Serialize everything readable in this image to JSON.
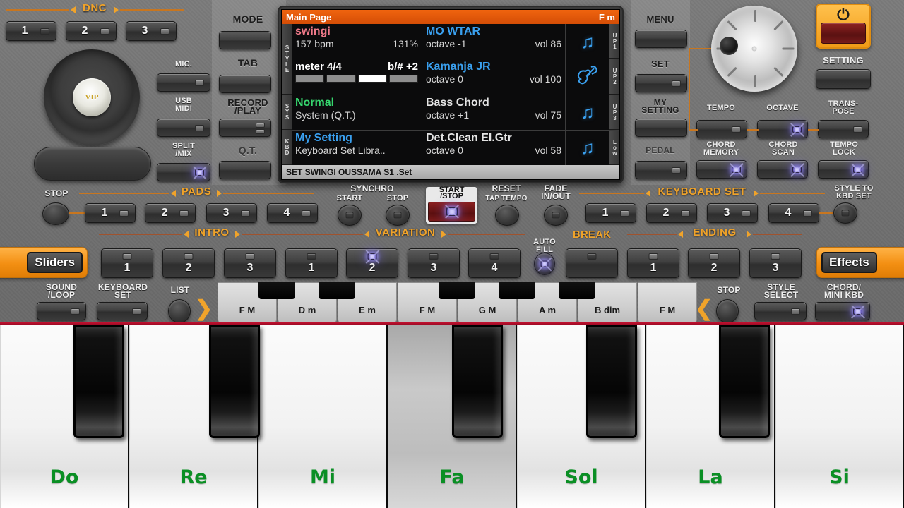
{
  "display": {
    "title": "Main Page",
    "chord": "F m",
    "side_tabs_left": [
      "STYLE",
      "SYS",
      "KBD"
    ],
    "side_tabs_right": [
      "UP1",
      "UP2",
      "UP3",
      "Low"
    ],
    "rows": [
      {
        "left_name": "swingi",
        "left_line2_a": "157 bpm",
        "left_line2_b": "131%",
        "left_line3_a": "meter 4/4",
        "left_line3_b": "b/# +2",
        "beats": [
          0,
          0,
          1,
          0
        ],
        "right_name": "MO WTAR",
        "right_octave": "octave -1",
        "right_vol": "vol 86",
        "icon": "music-note-icon",
        "tab": "UP1"
      },
      {
        "right_name": "Kamanja JR",
        "right_octave": "octave  0",
        "right_vol": "vol 100",
        "icon": "violin-icon",
        "tab": "UP2"
      },
      {
        "left_name": "Normal",
        "left_sub": "System (Q.T.)",
        "right_name": "Bass Chord",
        "right_octave": "octave +1",
        "right_vol": "vol 75",
        "icon": "music-note-icon",
        "tab": "UP3"
      },
      {
        "left_name": "My Setting",
        "left_sub": "Keyboard Set Libra..",
        "right_name": "Det.Clean El.Gtr",
        "right_octave": "octave  0",
        "right_vol": "vol 58",
        "icon": "music-note-icon",
        "tab": "Low"
      }
    ],
    "footer": "SET SWINGI OUSSAMA S1 .Set"
  },
  "dnc": {
    "label": "DNC",
    "buttons": [
      "1",
      "2",
      "3"
    ]
  },
  "jog": {
    "center_label": "VIP"
  },
  "left_side_buttons": [
    {
      "label": "MIC."
    },
    {
      "label": "USB\nMIDI"
    },
    {
      "label": "SPLIT\n/MIX"
    }
  ],
  "mode_column": [
    {
      "label": "MODE"
    },
    {
      "label": "TAB"
    },
    {
      "label": "RECORD\n/PLAY"
    },
    {
      "label": "Q.T."
    }
  ],
  "right_column": [
    {
      "label": "MENU"
    },
    {
      "label": "SET"
    },
    {
      "label": "MY\nSETTING"
    },
    {
      "label": "PEDAL"
    }
  ],
  "power": {
    "glyph": "power-icon"
  },
  "setting": {
    "label": "SETTING"
  },
  "value_row_1": [
    {
      "label": "TEMPO"
    },
    {
      "label": "OCTAVE"
    },
    {
      "label": "TRANS-\nPOSE"
    }
  ],
  "value_row_2": [
    {
      "label": "CHORD\nMEMORY"
    },
    {
      "label": "CHORD\nSCAN"
    },
    {
      "label": "TEMPO\nLOCK"
    }
  ],
  "pads": {
    "rail": "PADS",
    "stop_label": "STOP",
    "buttons": [
      "1",
      "2",
      "3",
      "4"
    ]
  },
  "synchro": {
    "label": "SYNCHRO",
    "start": "START",
    "stop": "STOP"
  },
  "transport": {
    "start_stop": "START\n/STOP",
    "reset": "RESET",
    "tap_tempo": "TAP TEMPO",
    "fade": "FADE\nIN/OUT"
  },
  "keyboard_set": {
    "rail": "KEYBOARD SET",
    "buttons": [
      "1",
      "2",
      "3",
      "4"
    ]
  },
  "style_to_kbd": {
    "label": "STYLE TO\nKBD SET"
  },
  "intro": {
    "rail": "INTRO",
    "buttons": [
      "1",
      "2",
      "3"
    ]
  },
  "variation": {
    "rail": "VARIATION",
    "buttons": [
      "1",
      "2",
      "3",
      "4"
    ],
    "active": 1
  },
  "auto_fill": {
    "label": "AUTO\nFILL"
  },
  "break": {
    "label": "BREAK"
  },
  "ending": {
    "rail": "ENDING",
    "buttons": [
      "1",
      "2",
      "3"
    ]
  },
  "tabs": {
    "sliders": "Sliders",
    "effects": "Effects"
  },
  "bottom_left": [
    {
      "label": "SOUND\n/LOOP"
    },
    {
      "label": "KEYBOARD\nSET"
    }
  ],
  "list": {
    "label": "LIST"
  },
  "bottom_right": [
    {
      "label": "STOP"
    },
    {
      "label": "STYLE\nSELECT"
    },
    {
      "label": "CHORD/\nMINI KBD"
    }
  ],
  "chord_strip": [
    "F M",
    "D m",
    "E m",
    "F M",
    "G M",
    "A m",
    "B dim",
    "F M"
  ],
  "piano": {
    "white_keys": [
      "Do",
      "Re",
      "Mi",
      "Fa",
      "Sol",
      "La",
      "Si"
    ],
    "pressed_key": "Fa"
  },
  "colors": {
    "accent_orange": "#f0a32a",
    "rail_orange": "#c8761f",
    "display_title_bg": "#f0640f",
    "note_label_green": "#0a8f24",
    "led_lit": "#b9b3ef"
  }
}
